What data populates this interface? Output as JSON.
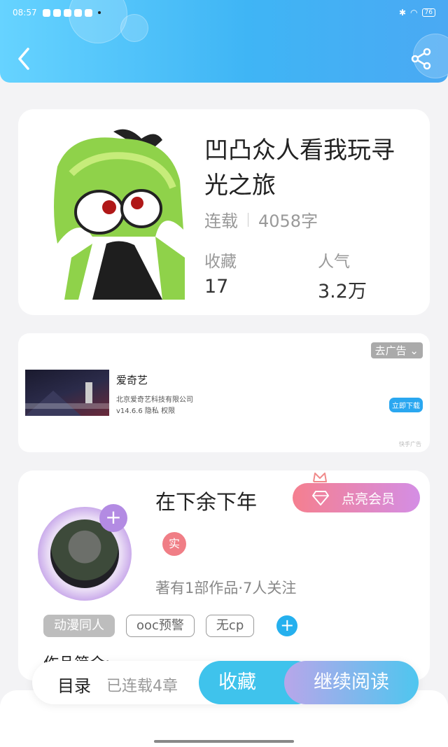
{
  "status_bar": {
    "time": "08:57",
    "battery": "76"
  },
  "book": {
    "title": "凹凸众人看我玩寻光之旅",
    "status": "连载",
    "word_count": "4058字",
    "favorites_label": "收藏",
    "favorites_value": "17",
    "popularity_label": "人气",
    "popularity_value": "3.2万"
  },
  "ad": {
    "close_label": "去广告",
    "app_name": "爱奇艺",
    "company": "北京爱奇艺科技有限公司",
    "version_info": "v14.6.6 隐私 权限",
    "download_label": "立即下载",
    "source_label": "快手广告"
  },
  "author": {
    "name": "在下余下年",
    "vip_label": "点亮会员",
    "verified_label": "实",
    "stats": "著有1部作品·7人关注",
    "tags": [
      "动漫同人",
      "ooc预警",
      "无cp"
    ],
    "intro_label": "作品简介:"
  },
  "bottom_bar": {
    "toc_label": "目录",
    "chapters_label": "已连载4章",
    "collect_label": "收藏",
    "read_label": "继续阅读"
  },
  "colors": {
    "header_start": "#66d3ff",
    "header_end": "#4aa9f3",
    "accent": "#3fc3ec"
  },
  "icons": [
    "back-arrow-icon",
    "share-icon",
    "gem-icon",
    "crown-icon",
    "plus-icon"
  ]
}
